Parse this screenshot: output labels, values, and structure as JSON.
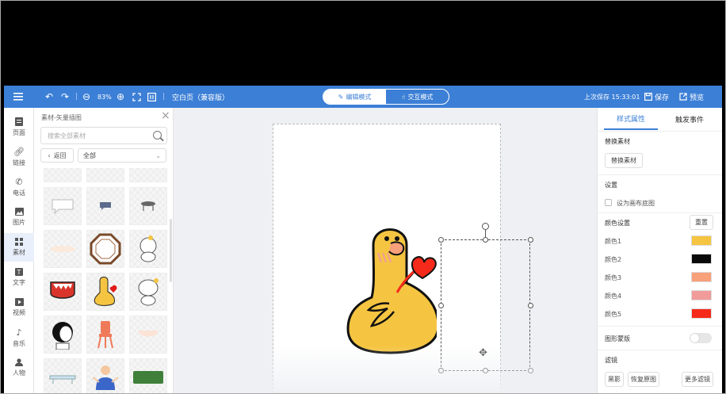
{
  "toolbar": {
    "zoom": "83%",
    "page_name": "空白页（兼容版）",
    "mode_edit": "编辑模式",
    "mode_interact": "交互模式",
    "last_saved": "上次保存 15:33:01",
    "save": "保存",
    "preview": "预览"
  },
  "sidebar": {
    "items": [
      {
        "label": "页面"
      },
      {
        "label": "链接"
      },
      {
        "label": "电话"
      },
      {
        "label": "图片"
      },
      {
        "label": "素材"
      },
      {
        "label": "文字"
      },
      {
        "label": "视频"
      },
      {
        "label": "音乐"
      },
      {
        "label": "人物"
      }
    ]
  },
  "material_panel": {
    "title": "素材-矢量插图",
    "search_placeholder": "搜索全部素材",
    "back": "返回",
    "filter_value": "全部"
  },
  "right_panel": {
    "tab_style": "样式属性",
    "tab_events": "触发事件",
    "replace_section": "替换素材",
    "replace_button": "替换素材",
    "settings_section": "设置",
    "set_background": "设为画布底图",
    "color_section": "颜色设置",
    "reset": "重置",
    "colors": [
      {
        "label": "颜色1",
        "value": "#f5c542"
      },
      {
        "label": "颜色2",
        "value": "#0a0a0a"
      },
      {
        "label": "颜色3",
        "value": "#f7a07a"
      },
      {
        "label": "颜色4",
        "value": "#f29b9b"
      },
      {
        "label": "颜色5",
        "value": "#f52a1a"
      }
    ],
    "mask_section": "图形蒙版",
    "filter_section": "滤镜",
    "filter_btn_1": "黑影",
    "filter_btn_2": "恢复原图",
    "filter_btn_3": "更多滤镜"
  },
  "colors": {
    "toolbar_bg": "#3c7fd6",
    "accent": "#3c7fd6"
  }
}
